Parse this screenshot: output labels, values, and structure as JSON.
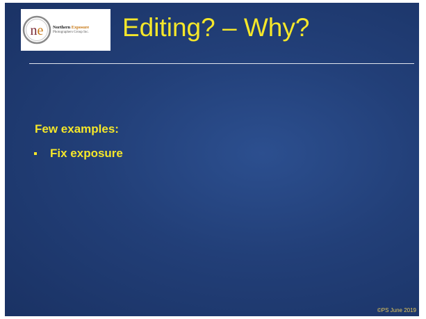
{
  "slide": {
    "title": "Editing? – Why?",
    "logo": {
      "monogram": "ne",
      "name_part1": "Northern ",
      "name_part2": "Exposure",
      "subtitle": "Photographers Group Inc."
    },
    "heading": "Few examples:",
    "bullets": [
      "Fix exposure"
    ],
    "footer": "©PS June 2019"
  },
  "colors": {
    "background": "#223f78",
    "text_accent": "#f5e72a",
    "rule": "#e2e6ee",
    "logo_orange": "#c87a18"
  }
}
